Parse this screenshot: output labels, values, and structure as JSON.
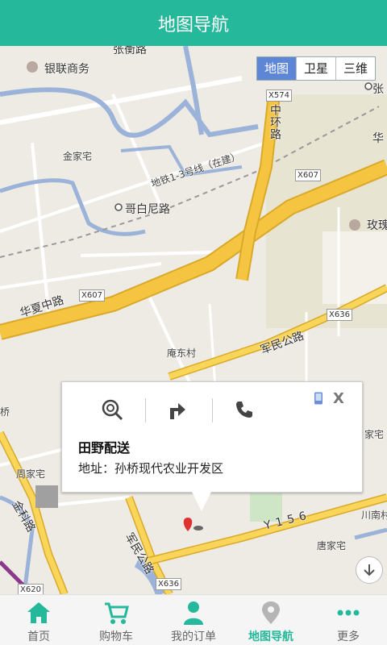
{
  "header": {
    "title": "地图导航"
  },
  "map_type": {
    "options": [
      "地图",
      "卫星",
      "三维"
    ],
    "selected": "地图"
  },
  "map_labels": {
    "place_yinlian": "银联商务",
    "place_jinjia": "金家宅",
    "road_gebaini": "哥白尼路",
    "road_metro": "地铁1-3号线（在建）",
    "road_huaxia": "华夏中路",
    "road_huaxia_right": "华",
    "road_zhonghuan": "中环路",
    "road_zhang_top": "张",
    "road_zhang_top_left": "张衡路",
    "road_junmin": "军民公路",
    "road_junmin_lower": "军民公路",
    "road_jinke": "金科路",
    "place_meigui": "玫瑰",
    "place_andong": "庵东村",
    "place_zhoujia": "周家宅",
    "place_tangjia": "唐家宅",
    "place_chuannan": "川南村",
    "place_jia": "家宅",
    "place_qiao": "桥",
    "road_y156": "Y156",
    "shield_x574": "X574",
    "shield_x607_a": "X607",
    "shield_x607_b": "X607",
    "shield_x636_a": "X636",
    "shield_x636_b": "X636",
    "shield_x620": "X620"
  },
  "popup": {
    "title": "田野配送",
    "address": "地址：孙桥现代农业开发区",
    "close": "X"
  },
  "tabs": [
    {
      "label": "首页",
      "icon": "home-icon"
    },
    {
      "label": "购物车",
      "icon": "cart-icon"
    },
    {
      "label": "我的订单",
      "icon": "user-icon"
    },
    {
      "label": "地图导航",
      "icon": "map-pin-icon",
      "active": true
    },
    {
      "label": "更多",
      "icon": "more-icon"
    }
  ],
  "colors": {
    "accent": "#26b89a",
    "maptype_active": "#5d86d6",
    "road_major": "#f5c542"
  }
}
